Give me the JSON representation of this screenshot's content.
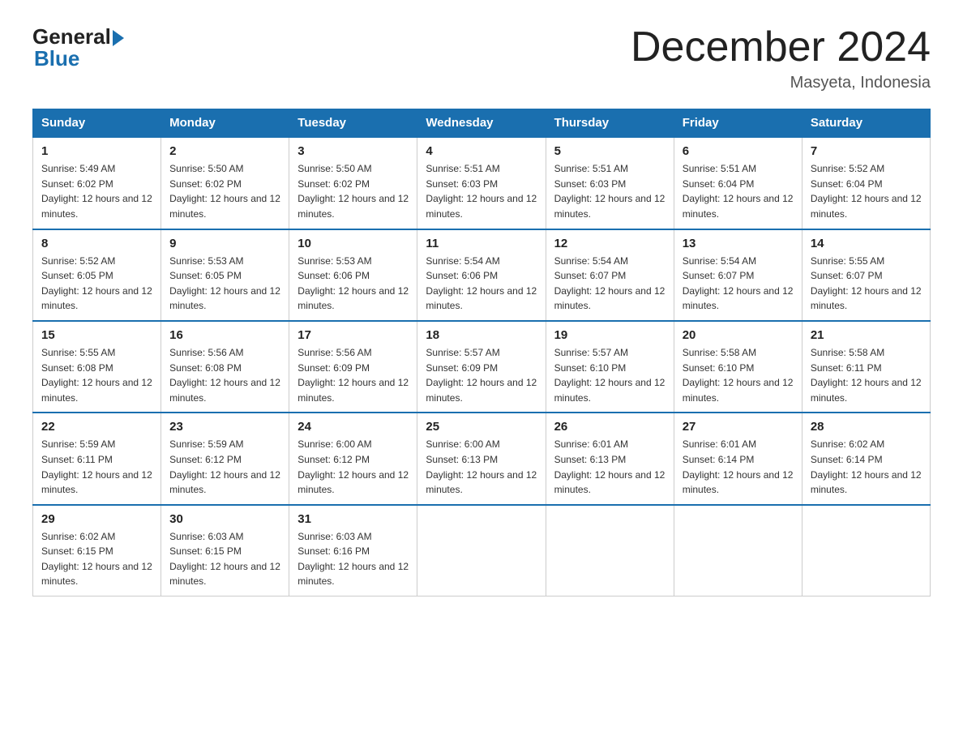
{
  "logo": {
    "general": "General",
    "blue": "Blue"
  },
  "title": "December 2024",
  "subtitle": "Masyeta, Indonesia",
  "days_of_week": [
    "Sunday",
    "Monday",
    "Tuesday",
    "Wednesday",
    "Thursday",
    "Friday",
    "Saturday"
  ],
  "weeks": [
    [
      {
        "day": "1",
        "sunrise": "5:49 AM",
        "sunset": "6:02 PM",
        "daylight": "12 hours and 12 minutes."
      },
      {
        "day": "2",
        "sunrise": "5:50 AM",
        "sunset": "6:02 PM",
        "daylight": "12 hours and 12 minutes."
      },
      {
        "day": "3",
        "sunrise": "5:50 AM",
        "sunset": "6:02 PM",
        "daylight": "12 hours and 12 minutes."
      },
      {
        "day": "4",
        "sunrise": "5:51 AM",
        "sunset": "6:03 PM",
        "daylight": "12 hours and 12 minutes."
      },
      {
        "day": "5",
        "sunrise": "5:51 AM",
        "sunset": "6:03 PM",
        "daylight": "12 hours and 12 minutes."
      },
      {
        "day": "6",
        "sunrise": "5:51 AM",
        "sunset": "6:04 PM",
        "daylight": "12 hours and 12 minutes."
      },
      {
        "day": "7",
        "sunrise": "5:52 AM",
        "sunset": "6:04 PM",
        "daylight": "12 hours and 12 minutes."
      }
    ],
    [
      {
        "day": "8",
        "sunrise": "5:52 AM",
        "sunset": "6:05 PM",
        "daylight": "12 hours and 12 minutes."
      },
      {
        "day": "9",
        "sunrise": "5:53 AM",
        "sunset": "6:05 PM",
        "daylight": "12 hours and 12 minutes."
      },
      {
        "day": "10",
        "sunrise": "5:53 AM",
        "sunset": "6:06 PM",
        "daylight": "12 hours and 12 minutes."
      },
      {
        "day": "11",
        "sunrise": "5:54 AM",
        "sunset": "6:06 PM",
        "daylight": "12 hours and 12 minutes."
      },
      {
        "day": "12",
        "sunrise": "5:54 AM",
        "sunset": "6:07 PM",
        "daylight": "12 hours and 12 minutes."
      },
      {
        "day": "13",
        "sunrise": "5:54 AM",
        "sunset": "6:07 PM",
        "daylight": "12 hours and 12 minutes."
      },
      {
        "day": "14",
        "sunrise": "5:55 AM",
        "sunset": "6:07 PM",
        "daylight": "12 hours and 12 minutes."
      }
    ],
    [
      {
        "day": "15",
        "sunrise": "5:55 AM",
        "sunset": "6:08 PM",
        "daylight": "12 hours and 12 minutes."
      },
      {
        "day": "16",
        "sunrise": "5:56 AM",
        "sunset": "6:08 PM",
        "daylight": "12 hours and 12 minutes."
      },
      {
        "day": "17",
        "sunrise": "5:56 AM",
        "sunset": "6:09 PM",
        "daylight": "12 hours and 12 minutes."
      },
      {
        "day": "18",
        "sunrise": "5:57 AM",
        "sunset": "6:09 PM",
        "daylight": "12 hours and 12 minutes."
      },
      {
        "day": "19",
        "sunrise": "5:57 AM",
        "sunset": "6:10 PM",
        "daylight": "12 hours and 12 minutes."
      },
      {
        "day": "20",
        "sunrise": "5:58 AM",
        "sunset": "6:10 PM",
        "daylight": "12 hours and 12 minutes."
      },
      {
        "day": "21",
        "sunrise": "5:58 AM",
        "sunset": "6:11 PM",
        "daylight": "12 hours and 12 minutes."
      }
    ],
    [
      {
        "day": "22",
        "sunrise": "5:59 AM",
        "sunset": "6:11 PM",
        "daylight": "12 hours and 12 minutes."
      },
      {
        "day": "23",
        "sunrise": "5:59 AM",
        "sunset": "6:12 PM",
        "daylight": "12 hours and 12 minutes."
      },
      {
        "day": "24",
        "sunrise": "6:00 AM",
        "sunset": "6:12 PM",
        "daylight": "12 hours and 12 minutes."
      },
      {
        "day": "25",
        "sunrise": "6:00 AM",
        "sunset": "6:13 PM",
        "daylight": "12 hours and 12 minutes."
      },
      {
        "day": "26",
        "sunrise": "6:01 AM",
        "sunset": "6:13 PM",
        "daylight": "12 hours and 12 minutes."
      },
      {
        "day": "27",
        "sunrise": "6:01 AM",
        "sunset": "6:14 PM",
        "daylight": "12 hours and 12 minutes."
      },
      {
        "day": "28",
        "sunrise": "6:02 AM",
        "sunset": "6:14 PM",
        "daylight": "12 hours and 12 minutes."
      }
    ],
    [
      {
        "day": "29",
        "sunrise": "6:02 AM",
        "sunset": "6:15 PM",
        "daylight": "12 hours and 12 minutes."
      },
      {
        "day": "30",
        "sunrise": "6:03 AM",
        "sunset": "6:15 PM",
        "daylight": "12 hours and 12 minutes."
      },
      {
        "day": "31",
        "sunrise": "6:03 AM",
        "sunset": "6:16 PM",
        "daylight": "12 hours and 12 minutes."
      },
      null,
      null,
      null,
      null
    ]
  ]
}
